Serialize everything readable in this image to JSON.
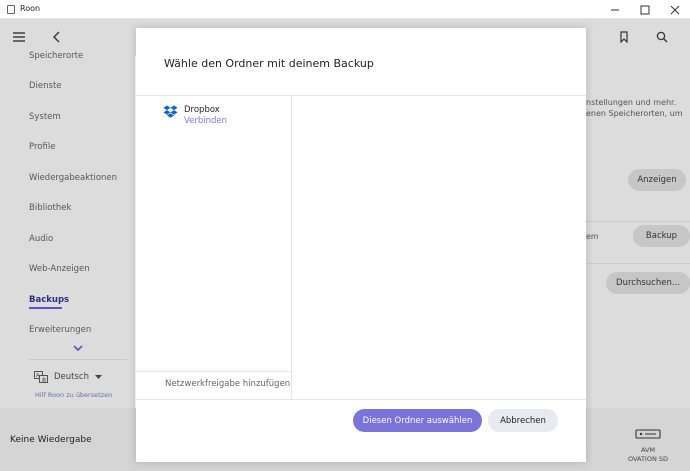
{
  "window": {
    "title": "Roon"
  },
  "sidebar": {
    "items": [
      {
        "label": "Speicherorte"
      },
      {
        "label": "Dienste"
      },
      {
        "label": "System"
      },
      {
        "label": "Profile"
      },
      {
        "label": "Wiedergabeaktionen"
      },
      {
        "label": "Bibliothek"
      },
      {
        "label": "Audio"
      },
      {
        "label": "Web-Anzeigen"
      },
      {
        "label": "Backups"
      },
      {
        "label": "Erweiterungen"
      }
    ],
    "active_item": "Backups",
    "language": "Deutsch",
    "translate_link": "Hilf Roon zu übersetzen"
  },
  "main": {
    "text_line_1": "nstellungen und mehr.",
    "text_line_2": "enen Speicherorten, um",
    "text_partial": "em",
    "view_button": "Anzeigen",
    "backup_button": "Backup",
    "browse_button": "Durchsuchen..."
  },
  "modal": {
    "title": "Wähle den Ordner mit deinem Backup",
    "source": {
      "name": "Dropbox",
      "action": "Verbinden"
    },
    "add_share": "Netzwerkfreigabe hinzufügen",
    "confirm_button": "Diesen Ordner auswählen",
    "cancel_button": "Abbrechen"
  },
  "footer": {
    "now_playing": "Keine Wiedergabe",
    "zone_line_1": "AVM",
    "zone_line_2": "OVATION SD"
  },
  "colors": {
    "accent": "#7b73dc",
    "link": "#7d77d8",
    "dropbox": "#0f61d8"
  }
}
